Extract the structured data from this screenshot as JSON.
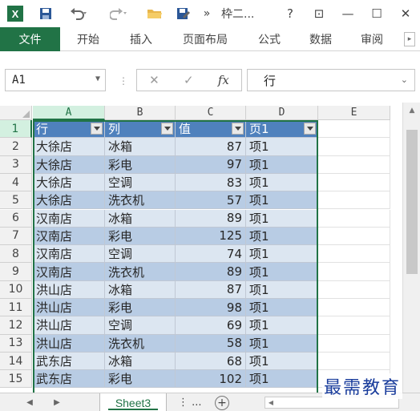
{
  "titlebar": {
    "app_logo": "X",
    "title": "枠二...",
    "more": "»",
    "help": "?",
    "restore": "⊡",
    "minimize": "—",
    "maximize": "☐",
    "close": "✕"
  },
  "ribbon": {
    "tabs": [
      "文件",
      "开始",
      "插入",
      "页面布局",
      "公式",
      "数据",
      "审阅"
    ]
  },
  "formula_bar": {
    "name_box": "A1",
    "cancel": "✕",
    "enter": "✓",
    "fx": "fx",
    "value": "行"
  },
  "grid": {
    "columns": [
      "A",
      "B",
      "C",
      "D",
      "E"
    ],
    "selected_column": "A",
    "selected_row": "1",
    "header": [
      "行",
      "列",
      "值",
      "页1"
    ],
    "rows": [
      [
        "大徐店",
        "冰箱",
        "87",
        "项1"
      ],
      [
        "大徐店",
        "彩电",
        "97",
        "项1"
      ],
      [
        "大徐店",
        "空调",
        "83",
        "项1"
      ],
      [
        "大徐店",
        "洗衣机",
        "57",
        "项1"
      ],
      [
        "汉南店",
        "冰箱",
        "89",
        "项1"
      ],
      [
        "汉南店",
        "彩电",
        "125",
        "项1"
      ],
      [
        "汉南店",
        "空调",
        "74",
        "项1"
      ],
      [
        "汉南店",
        "洗衣机",
        "89",
        "项1"
      ],
      [
        "洪山店",
        "冰箱",
        "87",
        "项1"
      ],
      [
        "洪山店",
        "彩电",
        "98",
        "项1"
      ],
      [
        "洪山店",
        "空调",
        "69",
        "项1"
      ],
      [
        "洪山店",
        "洗衣机",
        "58",
        "项1"
      ],
      [
        "武东店",
        "冰箱",
        "68",
        "项1"
      ],
      [
        "武东店",
        "彩电",
        "102",
        "项1"
      ]
    ],
    "row_numbers": [
      "1",
      "2",
      "3",
      "4",
      "5",
      "6",
      "7",
      "8",
      "9",
      "10",
      "11",
      "12",
      "13",
      "14",
      "15"
    ]
  },
  "sheetbar": {
    "active_sheet": "Sheet3",
    "more": "⋮ ...",
    "add": "+"
  },
  "watermark": "最需教育",
  "colors": {
    "excel_green": "#217346",
    "pivot_header": "#4f81bd",
    "band_light": "#dce6f1",
    "band_dark": "#b8cce4"
  }
}
